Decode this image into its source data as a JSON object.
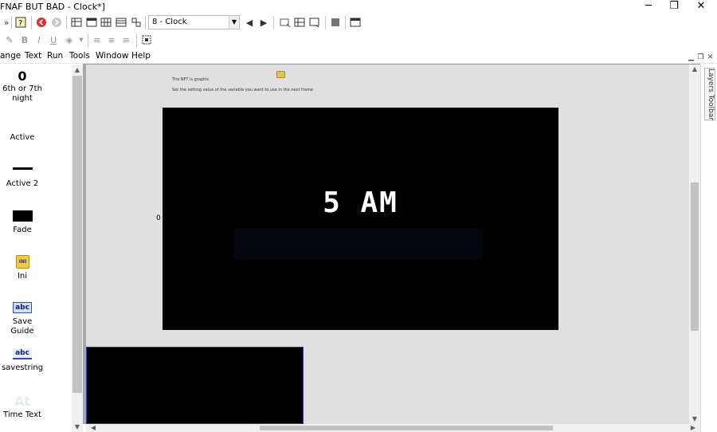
{
  "window": {
    "title": "FNAF BUT BAD - Clock*]",
    "minimize": "─",
    "restore": "❐",
    "close": "✕"
  },
  "toolbar": {
    "frame_select": "8 - Clock"
  },
  "menu": {
    "items": [
      "ange",
      "Text",
      "Run",
      "Tools",
      "Window",
      "Help"
    ]
  },
  "objects": [
    {
      "label": "6th or 7th night",
      "icon": "counter-icon",
      "icon_text": "0"
    },
    {
      "label": "Active",
      "icon": "active-icon",
      "icon_text": ""
    },
    {
      "label": "Active 2",
      "icon": "line-icon",
      "icon_text": ""
    },
    {
      "label": "Fade",
      "icon": "rectangle-icon",
      "icon_text": ""
    },
    {
      "label": "Ini",
      "icon": "ini-icon",
      "icon_text": "INI"
    },
    {
      "label": "Save Guide",
      "icon": "string-icon",
      "icon_text": "abc"
    },
    {
      "label": "savestring",
      "icon": "string-icon",
      "icon_text": "abc"
    },
    {
      "label": "Time Text",
      "icon": "text-icon",
      "icon_text": "At"
    }
  ],
  "editor": {
    "hint_line1": "The NFT is graphic",
    "hint_line2": "Set the setting value of the variable you want to use in the next frame",
    "counter_value": "0",
    "clock_text": "5 AM"
  },
  "layers_toolbar": {
    "label": "Layers Toolbar"
  },
  "colors": {
    "frame_bg": "#000000",
    "editor_bg": "#e0e0e0",
    "subframe_border": "#3a3ab8"
  }
}
